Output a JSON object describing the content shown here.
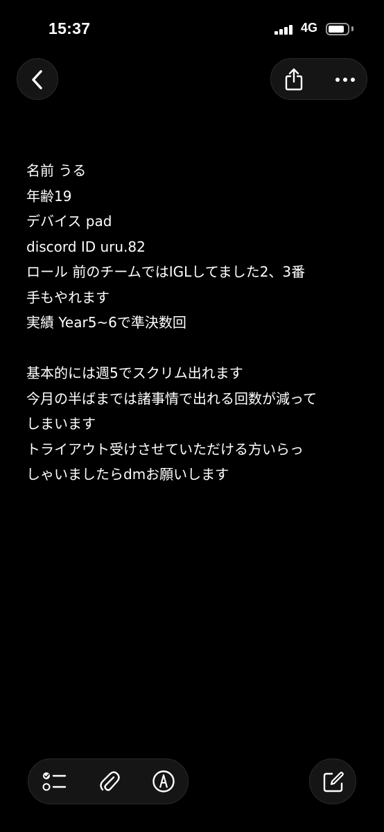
{
  "status_bar": {
    "time": "15:37",
    "network": "4G",
    "battery_level": 0.75,
    "signal_bars": 4
  },
  "header": {
    "back_icon": "chevron-left-icon",
    "share_icon": "share-icon",
    "more_icon": "ellipsis-icon"
  },
  "note": {
    "lines": [
      "名前 うる",
      "年齢19",
      "デバイス pad",
      "discord ID uru.82",
      "ロール 前のチームではIGLしてました2、3番",
      "手もやれます",
      "実績 Year5~6で準決数回",
      "",
      "基本的には週5でスクリム出れます",
      "今月の半ばまでは諸事情で出れる回数が減って",
      "しまいます",
      "トライアウト受けさせていただける方いらっ",
      "しゃいましたらdmお願いします"
    ]
  },
  "toolbar": {
    "checklist_icon": "checklist-icon",
    "attachment_icon": "paperclip-icon",
    "markup_icon": "pen-circle-icon",
    "compose_icon": "compose-icon"
  },
  "colors": {
    "background": "#000000",
    "text": "#ffffff",
    "button_bg": "#151515"
  }
}
